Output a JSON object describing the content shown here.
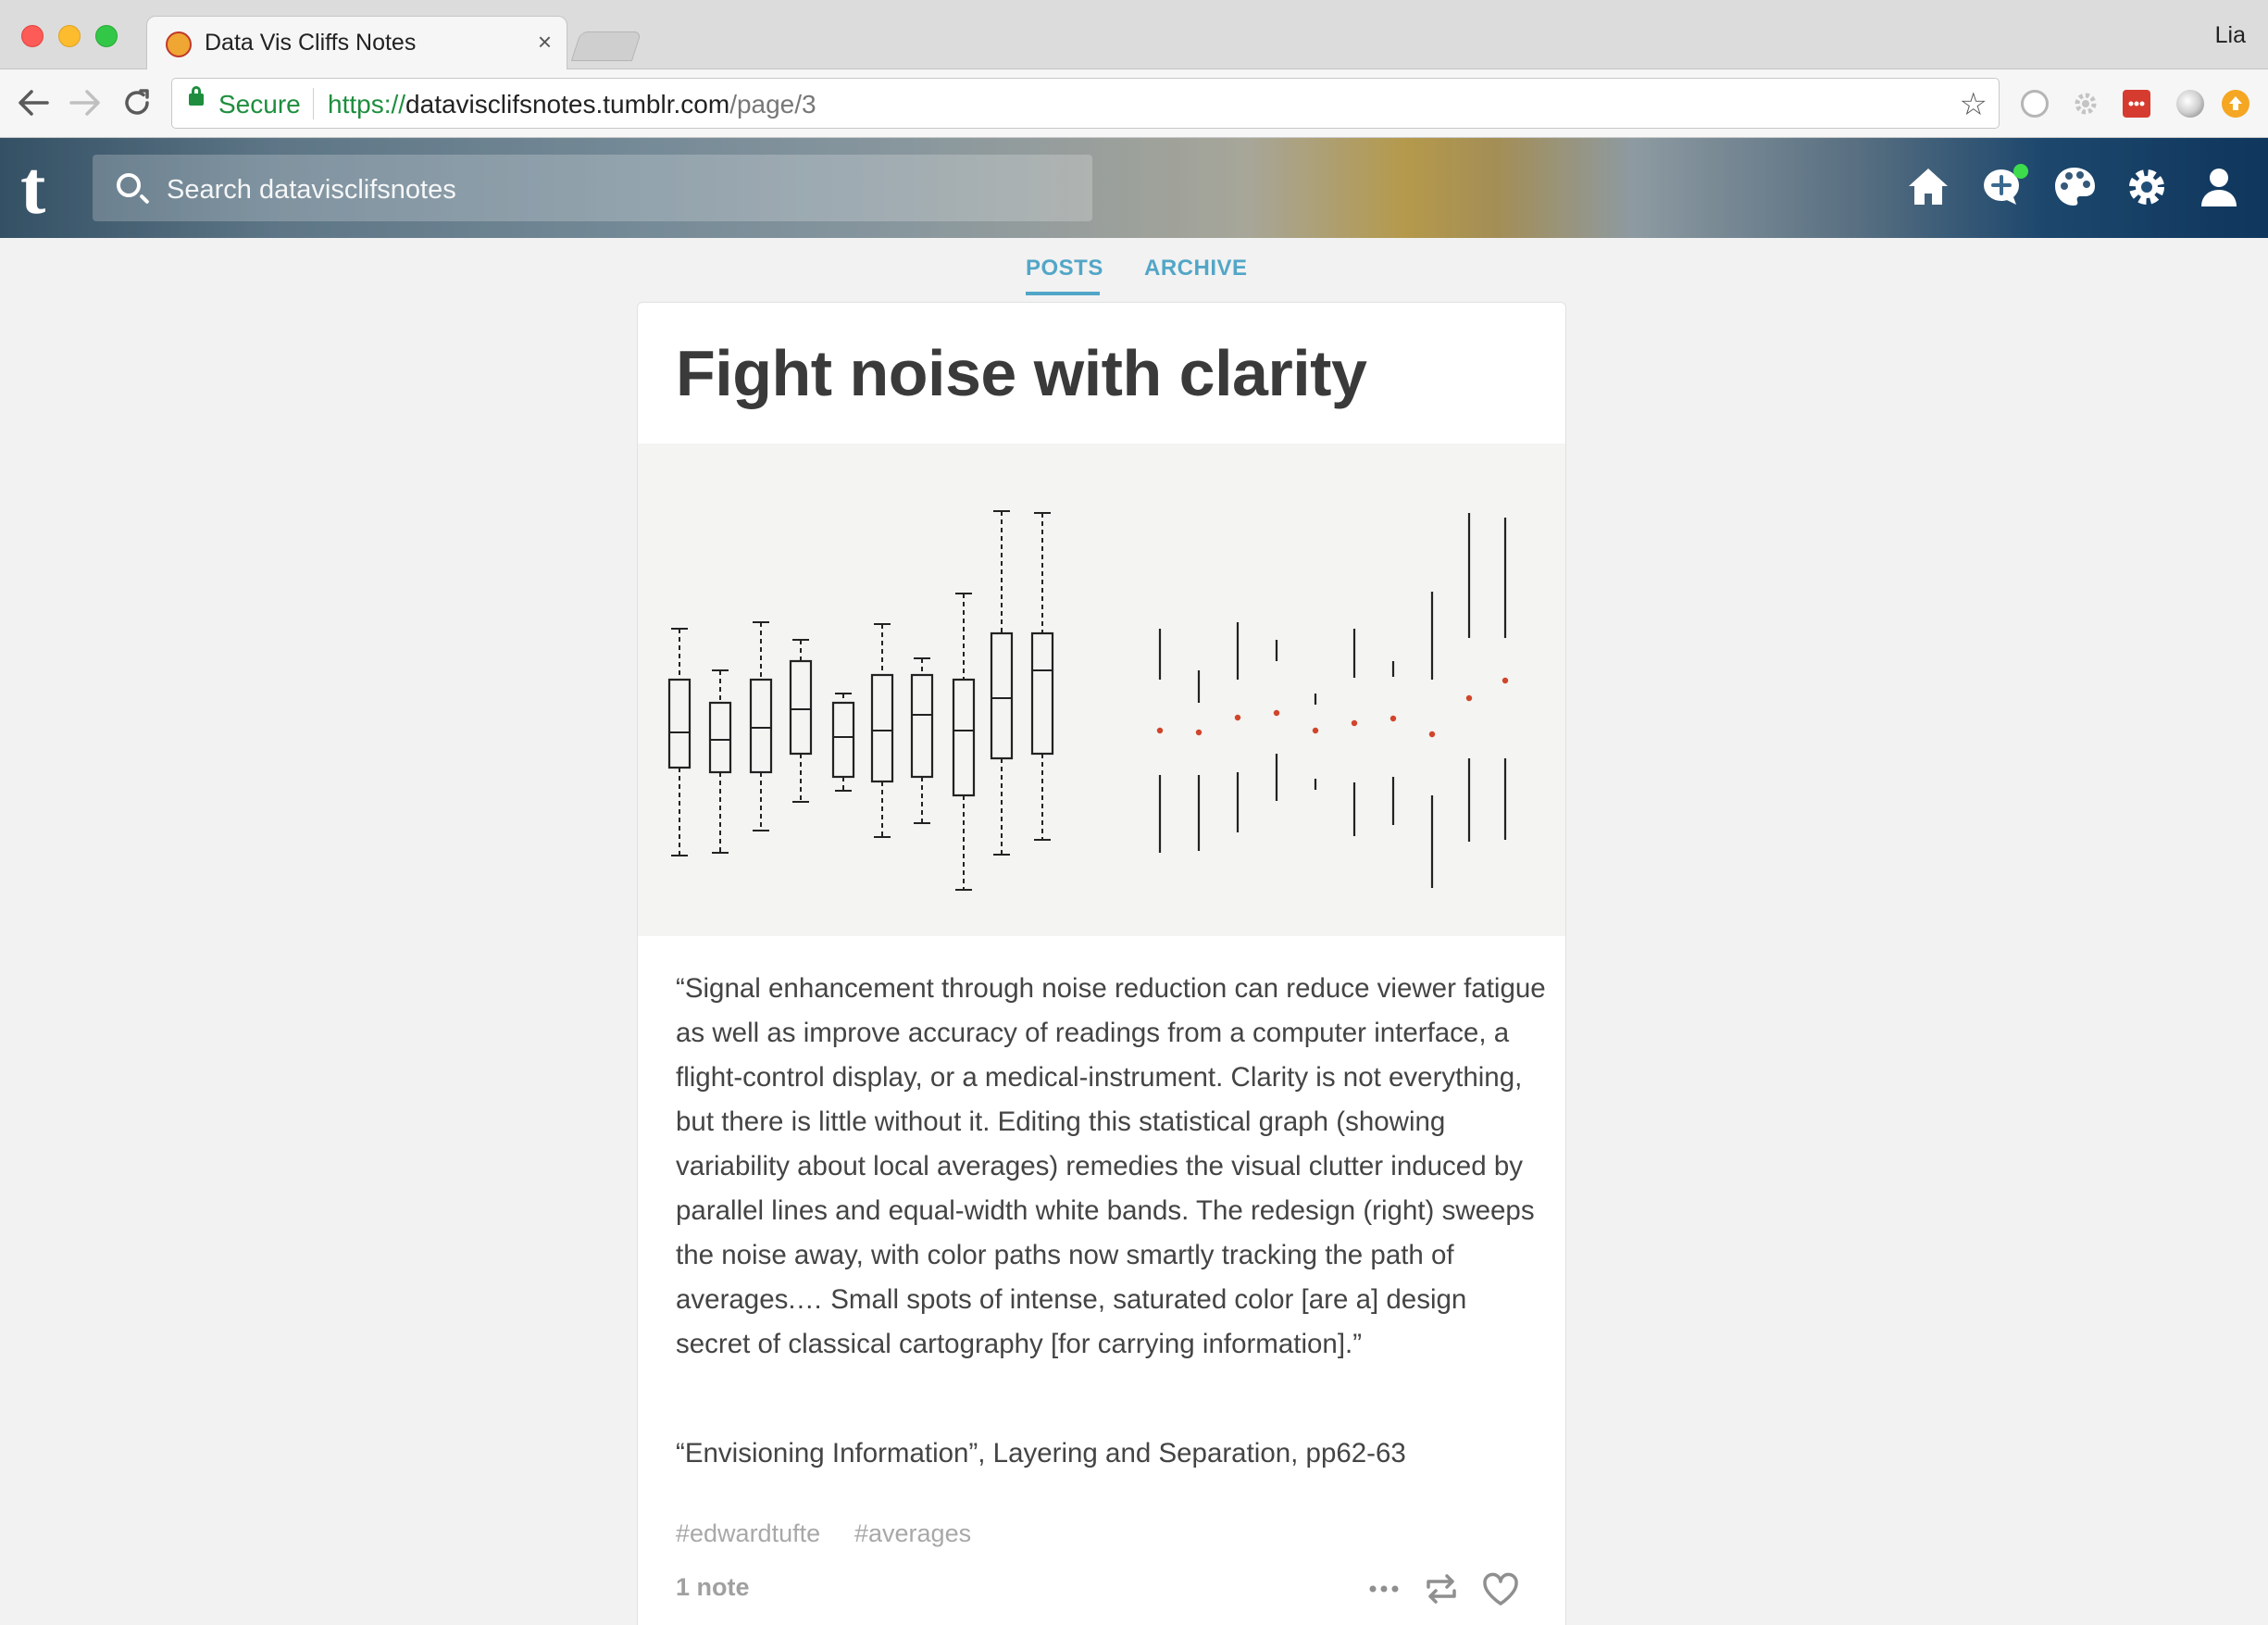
{
  "browser": {
    "tab_title": "Data Vis Cliffs Notes",
    "tab_close": "×",
    "profile_name": "Lia",
    "secure_label": "Secure",
    "url_scheme": "https://",
    "url_host": "datavisclifsnotes.tumblr.com",
    "url_path": "/page/3",
    "icons": [
      "back-icon",
      "forward-icon",
      "reload-icon",
      "lock-icon",
      "star-icon"
    ]
  },
  "header": {
    "logo": "t",
    "search_placeholder": "Search datavisclifsnotes",
    "icons": [
      "home-icon",
      "compose-icon",
      "palette-icon",
      "gear-icon",
      "account-icon"
    ],
    "notification_color": "#3ddc4c"
  },
  "blog_nav": {
    "tabs": [
      {
        "label": "POSTS",
        "active": true
      },
      {
        "label": "ARCHIVE",
        "active": false
      }
    ],
    "accent_color": "#52a6c7"
  },
  "post": {
    "title": "Fight noise with clarity",
    "body": "“Signal enhancement through noise reduction can reduce viewer fatigue as well as improve accuracy of readings from a computer interface, a flight-control display, or a medical-instrument. Clarity is not everything, but there is little without it. Editing this statistical graph (showing variability about local averages) remedies the visual clutter induced by parallel lines and equal-width white bands. The redesign (right) sweeps the noise away, with color paths now smartly tracking the path of averages.… Small spots of intense, saturated color [are a] design secret of classical cartography [for carrying information].”",
    "source": "“Envisioning Information”, Layering and Separation, pp62-63",
    "tags": [
      "#edwardtufte",
      "#averages"
    ],
    "notes": "1 note",
    "actions": [
      "more-icon",
      "reblog-icon",
      "like-icon"
    ],
    "figure": {
      "type": "box-plot-comparison",
      "marker_color": "#d0452b"
    }
  }
}
